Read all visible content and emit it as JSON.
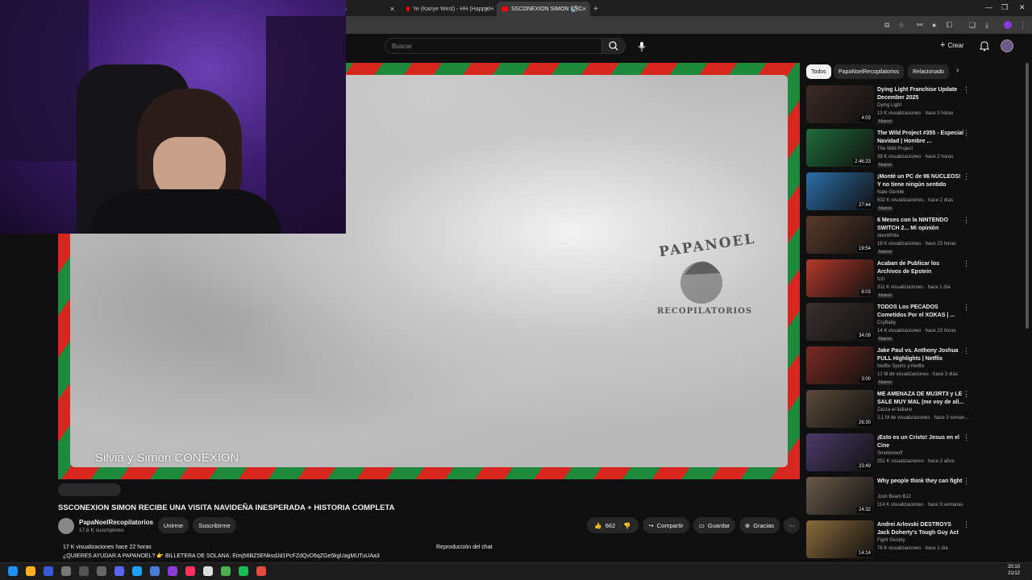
{
  "browser": {
    "tabs": [
      {
        "label": "a"
      },
      {
        "label": "Ye (Kanye West) - HH (Happy H"
      },
      {
        "label": "SSCONEXION SIMON REC"
      }
    ],
    "new_tab": "+"
  },
  "youtube": {
    "search_placeholder": "Buscar",
    "create_label": "Crear"
  },
  "player": {
    "overlay_text": "Silvia y Simon CONEXION",
    "stamp_top": "PAPANOEL",
    "stamp_bottom": "RECOPILATORIOS"
  },
  "video": {
    "title": "SSCONEXION SIMON RECIBE UNA VISITA NAVIDEÑA INESPERADA + HISTORIA COMPLETA",
    "channel": "PapaNoelRecopilatorios",
    "subscribers": "17,6 K suscriptores",
    "join_label": "Unirme",
    "subscribe_label": "Suscribirme",
    "likes": "662",
    "share_label": "Compartir",
    "save_label": "Guardar",
    "thanks_label": "Gracias",
    "views_date": "17 K visualizaciones  hace 22 horas",
    "desc_line": "¿QUIERES AYUDAR A PAPANOEL? 👉 BILLETERA DE SOLANA: Eimj56BZ5ENksdJd1PcFZdQvD6qZGe5kgUagMUTuUAa3",
    "desc_line2": "",
    "chat_label": "Reproducción del chat"
  },
  "sidebar": {
    "chips": [
      "Todos",
      "PapaNoelRecopilatorios",
      "Relacionado"
    ],
    "recs": [
      {
        "title": "Dying Light Franchise Update December 2025",
        "channel": "Dying Light",
        "meta": "13 K visualizaciones · hace 3 horas",
        "badge": "Nuevo",
        "duration": "4:03",
        "color": "#3b2a26"
      },
      {
        "title": "The Wild Project #355 - Especial Navidad | Hombre ...",
        "channel": "The Wild Project",
        "meta": "39 K visualizaciones · hace 2 horas",
        "badge": "Nuevo",
        "duration": "2:46:23",
        "color": "#1f6b3a"
      },
      {
        "title": "¡Monté un PC de 96 NÚCLEOS! Y no tiene ningún sentido",
        "channel": "Nate Gentile",
        "meta": "502 K visualizaciones · hace 2 días",
        "badge": "Nuevo",
        "duration": "27:44",
        "color": "#2b6ea8"
      },
      {
        "title": "6 Meses con la NINTENDO SWITCH 2... Mi opinión",
        "channel": "AlexWhite",
        "meta": "18 K visualizaciones · hace 23 horas",
        "badge": "Nuevo",
        "duration": "19:54",
        "color": "#5a3a2a"
      },
      {
        "title": "Acaban de Publicar los Archivos de Epstein",
        "channel": "Izzi",
        "meta": "311 K visualizaciones · hace 1 día",
        "badge": "Nuevo",
        "duration": "8:03",
        "color": "#b23a2a"
      },
      {
        "title": "TODOS Los PECADOS Cometidos Por el XOKAS | ...",
        "channel": "CryBaby",
        "meta": "14 K visualizaciones · hace 23 horas",
        "badge": "Nuevo",
        "duration": "34:09",
        "color": "#3a3030"
      },
      {
        "title": "Jake Paul vs. Anthony Joshua FULL Highlights | Netflix",
        "channel": "Netflix Sports y Netflix",
        "meta": "12 M de visualizaciones · hace 3 días",
        "badge": "Nuevo",
        "duration": "3:00",
        "color": "#7a2a22"
      },
      {
        "title": "ME AMENAZA DE MU3RT3 y LE SALE MUY MAL (me voy de all...",
        "channel": "Zazza el italiano",
        "meta": "2,1 M de visualizaciones · hace 3 seman...",
        "badge": "",
        "duration": "26:30",
        "color": "#5a4a3a"
      },
      {
        "title": "¡Esto es un Cristo! Jesus en el Cine",
        "channel": "Smokerwolf",
        "meta": "251 K visualizaciones · hace 2 años",
        "badge": "",
        "duration": "23:49",
        "color": "#4a3a6a"
      },
      {
        "title": "Why people think they can fight",
        "channel": "Josh Beam BJJ",
        "meta": "114 K visualizaciones · hace 3 semanas",
        "badge": "",
        "duration": "24:32",
        "color": "#6a5a4a"
      },
      {
        "title": "Andrei Arlovski DESTROYS Jack Doherty's Tough Guy Act",
        "channel": "Fight Society",
        "meta": "76 K visualizaciones · hace 1 día",
        "badge": "",
        "duration": "14:14",
        "color": "#8a6a3a"
      }
    ]
  },
  "taskbar": {
    "time": "20:10",
    "date": "21/12"
  },
  "colors": {
    "red": "#d7261e",
    "green": "#1e8a3c",
    "bg": "#0f0f0f"
  }
}
